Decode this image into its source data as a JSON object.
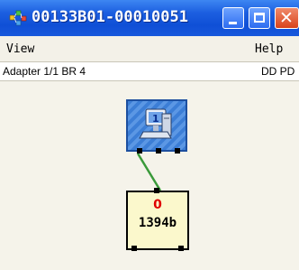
{
  "window": {
    "title": "00133B01-00010051",
    "close_glyph": "✕"
  },
  "menubar": {
    "items": [
      "View",
      "Help"
    ]
  },
  "infobar": {
    "left_text": "Adapter 1/1  BR 4",
    "right_text": "DD PD"
  },
  "topology": {
    "host_icon": "computer-icon",
    "device": {
      "count": "0",
      "label": "1394b"
    },
    "link_color": "#3a9a3a"
  },
  "colors": {
    "titlebar": "#1c5fe0",
    "close_button": "#d9441c",
    "device_fill": "#fbf8cc",
    "count_color": "#e00000"
  }
}
